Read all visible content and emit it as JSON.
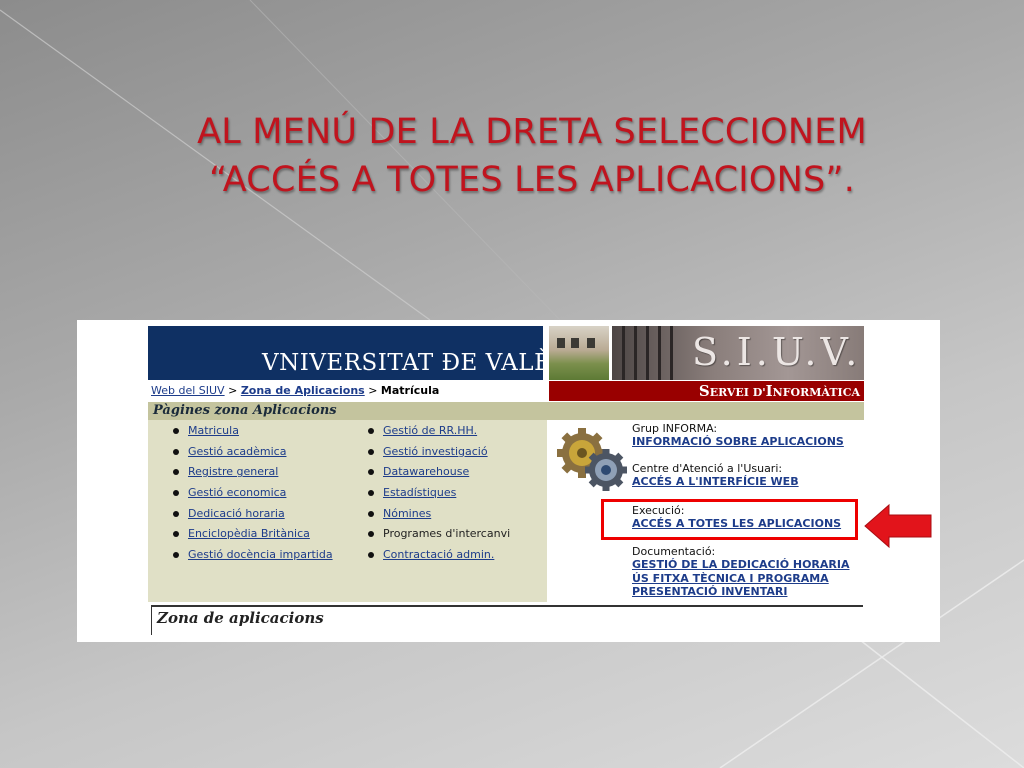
{
  "slide": {
    "title_line1": "AL MENÚ DE LA DRETA SELECCIONEM",
    "title_line2": "“ACCÉS A TOTES LES APLICACIONS”.",
    "title_color": "#c0141e"
  },
  "header": {
    "logo_text": "VNIVERSITAT ĐE VALÈNCIA",
    "siuv_text": "S.I.U.V.",
    "servei_first": "S",
    "servei_rest": "ERVEI D'",
    "servei_second": "I",
    "servei_rest2": "NFORMÀTICA",
    "banner_color": "#0f3063",
    "bar_color": "#990000"
  },
  "breadcrumb": {
    "item1": "Web del SIUV",
    "sep1": " > ",
    "item2": "Zona de Aplicacions",
    "sep2": " > ",
    "current": "Matrícula"
  },
  "panel": {
    "heading": "Pàgines zona Aplicacions",
    "col1": [
      {
        "label": "Matricula",
        "link": true
      },
      {
        "label": "Gestió acadèmica",
        "link": true
      },
      {
        "label": "Registre general",
        "link": true
      },
      {
        "label": "Gestió economica",
        "link": true
      },
      {
        "label": "Dedicació horaria",
        "link": true
      },
      {
        "label": "Enciclopèdia Britànica",
        "link": true
      },
      {
        "label": "Gestió docència impartida",
        "link": true
      }
    ],
    "col2": [
      {
        "label": "Gestió de RR.HH.",
        "link": true
      },
      {
        "label": "Gestió investigació",
        "link": true
      },
      {
        "label": "Datawarehouse",
        "link": true
      },
      {
        "label": "Estadístiques",
        "link": true
      },
      {
        "label": "Nómines",
        "link": true
      },
      {
        "label": "Programes d'intercanvi",
        "link": false
      },
      {
        "label": "Contractació admin.",
        "link": true
      }
    ]
  },
  "right_menu": {
    "grup_label": "Grup INFORMA:",
    "grup_link": "INFORMACIÓ SOBRE APLICACIONS",
    "centre_label": "Centre d'Atenció a l'Usuari:",
    "centre_link": "ACCÉS A L'INTERFÍCIE WEB",
    "exec_label": "Execució:",
    "exec_link": "ACCÉS A TOTES LES APLICACIONS",
    "doc_label": "Documentació:",
    "doc_link1": "GESTIÓ DE LA DEDICACIÓ HORARIA",
    "doc_link2": "ÚS FITXA TÈCNICA I PROGRAMA",
    "doc_link3": "PRESENTACIÓ INVENTARI"
  },
  "footer": {
    "zona_title": "Zona de aplicacions"
  },
  "icons": [
    "gears-icon",
    "red-arrow-icon"
  ]
}
